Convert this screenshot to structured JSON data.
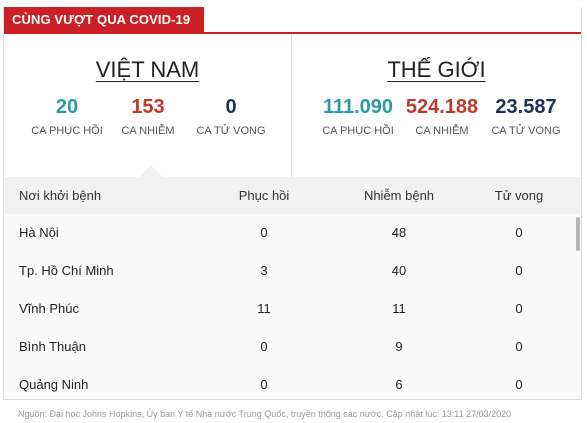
{
  "header": {
    "title": "CÙNG VƯỢT QUA COVID-19"
  },
  "colors": {
    "brand": "#cc2027",
    "recovered": "#2a9aaa",
    "infected": "#c0392b",
    "deaths": "#1d3057"
  },
  "vietnam": {
    "title": "VIỆT NAM",
    "recovered": {
      "value": "20",
      "label": "CA PHỤC HỒI"
    },
    "infected": {
      "value": "153",
      "label": "CA NHIỄM"
    },
    "deaths": {
      "value": "0",
      "label": "CA TỬ VONG"
    }
  },
  "world": {
    "title": "THẾ GIỚI",
    "recovered": {
      "value": "111.090",
      "label": "CA PHỤC HỒI"
    },
    "infected": {
      "value": "524.188",
      "label": "CA NHIỄM"
    },
    "deaths": {
      "value": "23.587",
      "label": "CA TỬ VONG"
    }
  },
  "table": {
    "headers": [
      "Nơi khởi bệnh",
      "Phục hồi",
      "Nhiễm bệnh",
      "Tử vong"
    ],
    "rows": [
      [
        "Hà Nội",
        "0",
        "48",
        "0"
      ],
      [
        "Tp. Hồ Chí Minh",
        "3",
        "40",
        "0"
      ],
      [
        "Vĩnh Phúc",
        "11",
        "11",
        "0"
      ],
      [
        "Bình Thuận",
        "0",
        "9",
        "0"
      ],
      [
        "Quảng Ninh",
        "0",
        "6",
        "0"
      ]
    ]
  },
  "source": "Nguồn: Đại học Johns Hopkins, Ủy ban Y tế Nhà nước Trung Quốc, truyền thông các nước. Cập nhật lúc: 13:11 27/03/2020"
}
